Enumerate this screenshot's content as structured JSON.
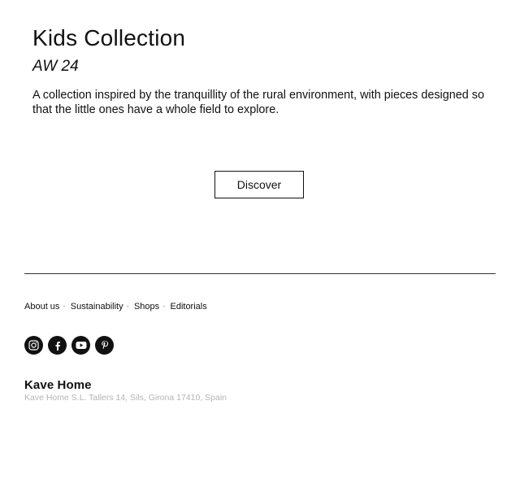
{
  "hero": {
    "title": "Kids Collection",
    "subtitle": "AW 24",
    "description": "A collection inspired by the tranquillity of the rural environment, with pieces designed so that the little ones have a whole field to explore.",
    "cta_label": "Discover"
  },
  "footer": {
    "links": [
      "About us",
      "Sustainability",
      "Shops",
      "Editorials"
    ],
    "separator": "·",
    "social_icons": [
      "instagram-icon",
      "facebook-icon",
      "youtube-icon",
      "pinterest-icon"
    ],
    "brand": "Kave Home",
    "address": "Kave Home S.L. Tallers 14, Sils, Girona 17410, Spain"
  },
  "colors": {
    "text": "#111111",
    "muted": "#b4b4b4",
    "background": "#ffffff"
  }
}
